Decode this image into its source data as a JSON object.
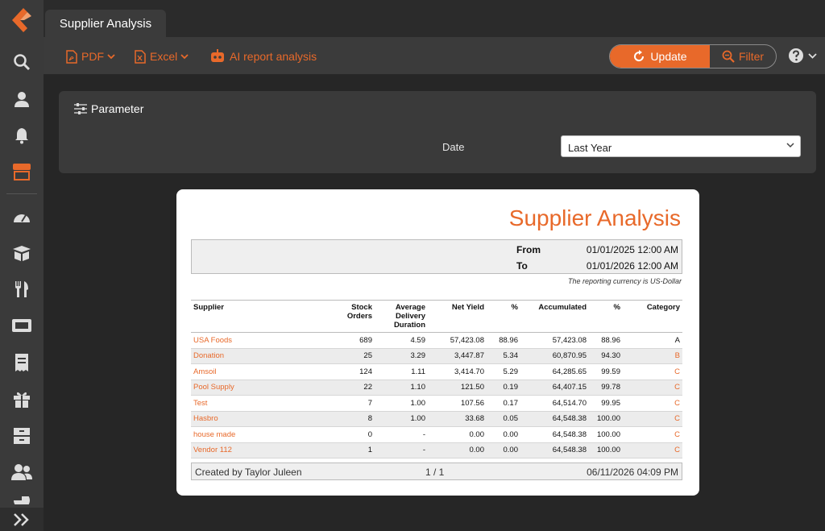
{
  "tab": {
    "title": "Supplier Analysis"
  },
  "toolbar": {
    "pdf_label": "PDF",
    "excel_label": "Excel",
    "ai_label": "AI report analysis",
    "update_label": "Update",
    "filter_label": "Filter"
  },
  "parameter": {
    "title": "Parameter",
    "date_label": "Date",
    "date_value": "Last Year"
  },
  "report": {
    "title": "Supplier Analysis",
    "from_label": "From",
    "from_value": "01/01/2025 12:00 AM",
    "to_label": "To",
    "to_value": "01/01/2026 12:00 AM",
    "currency_note": "The reporting currency is US-Dollar",
    "columns": {
      "supplier": "Supplier",
      "stock_orders_1": "Stock",
      "stock_orders_2": "Orders",
      "avg_1": "Average",
      "avg_2": "Delivery",
      "avg_3": "Duration",
      "net_yield": "Net Yield",
      "pct": "%",
      "accumulated": "Accumulated",
      "pct2": "%",
      "category": "Category"
    },
    "rows": [
      {
        "supplier": "USA Foods",
        "orders": "689",
        "avg": "4.59",
        "net": "57,423.08",
        "pct": "88.96",
        "acc": "57,423.08",
        "accpct": "88.96",
        "cat": "A"
      },
      {
        "supplier": "Donation",
        "orders": "25",
        "avg": "3.29",
        "net": "3,447.87",
        "pct": "5.34",
        "acc": "60,870.95",
        "accpct": "94.30",
        "cat": "B"
      },
      {
        "supplier": "Amsoil",
        "orders": "124",
        "avg": "1.11",
        "net": "3,414.70",
        "pct": "5.29",
        "acc": "64,285.65",
        "accpct": "99.59",
        "cat": "C"
      },
      {
        "supplier": "Pool Supply",
        "orders": "22",
        "avg": "1.10",
        "net": "121.50",
        "pct": "0.19",
        "acc": "64,407.15",
        "accpct": "99.78",
        "cat": "C"
      },
      {
        "supplier": "Test",
        "orders": "7",
        "avg": "1.00",
        "net": "107.56",
        "pct": "0.17",
        "acc": "64,514.70",
        "accpct": "99.95",
        "cat": "C"
      },
      {
        "supplier": "Hasbro",
        "orders": "8",
        "avg": "1.00",
        "net": "33.68",
        "pct": "0.05",
        "acc": "64,548.38",
        "accpct": "100.00",
        "cat": "C"
      },
      {
        "supplier": "house made",
        "orders": "0",
        "avg": "-",
        "net": "0.00",
        "pct": "0.00",
        "acc": "64,548.38",
        "accpct": "100.00",
        "cat": "C"
      },
      {
        "supplier": "Vendor 112",
        "orders": "1",
        "avg": "-",
        "net": "0.00",
        "pct": "0.00",
        "acc": "64,548.38",
        "accpct": "100.00",
        "cat": "C"
      }
    ],
    "footer": {
      "created_by": "Created by Taylor Juleen",
      "page": "1  /  1",
      "date": "06/11/2026 04:09 PM"
    }
  },
  "colors": {
    "accent": "#e8692a",
    "sidebar": "#3a3a3a",
    "background": "#262626"
  }
}
